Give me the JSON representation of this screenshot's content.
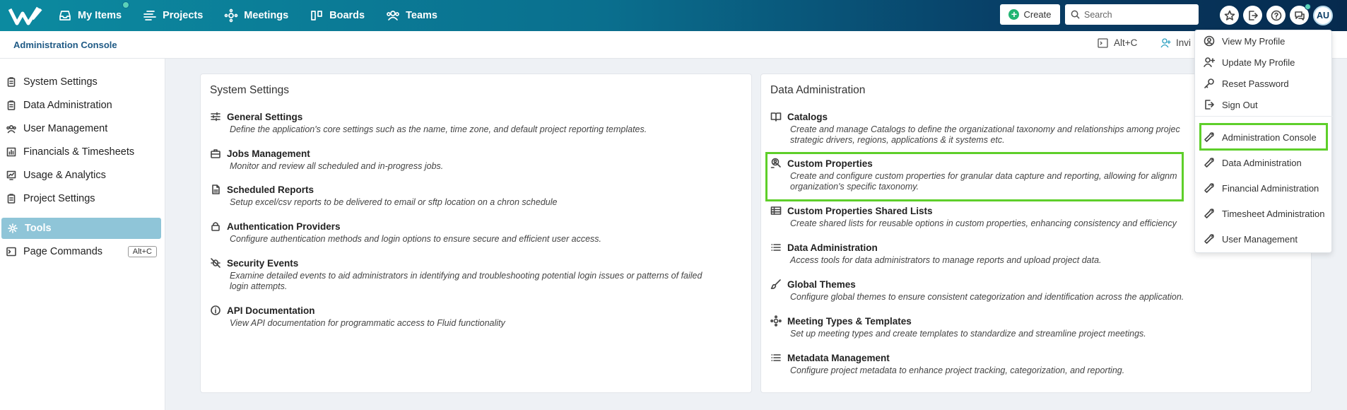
{
  "topnav": {
    "items": [
      {
        "label": "My Items",
        "icon": "inbox-icon"
      },
      {
        "label": "Projects",
        "icon": "projects-icon"
      },
      {
        "label": "Meetings",
        "icon": "meetings-icon"
      },
      {
        "label": "Boards",
        "icon": "boards-icon"
      },
      {
        "label": "Teams",
        "icon": "teams-icon"
      }
    ],
    "create_label": "Create",
    "search_placeholder": "Search",
    "avatar_initials": "AU"
  },
  "subheader": {
    "title": "Administration Console",
    "shortcut_label": "Alt+C",
    "invite_label": "Invi"
  },
  "sidebar": {
    "items": [
      {
        "label": "System Settings"
      },
      {
        "label": "Data Administration"
      },
      {
        "label": "User Management"
      },
      {
        "label": "Financials & Timesheets"
      },
      {
        "label": "Usage & Analytics"
      },
      {
        "label": "Project Settings"
      },
      {
        "label": "Tools",
        "active": true
      },
      {
        "label": "Page Commands",
        "shortcut": "Alt+C"
      }
    ]
  },
  "system_settings": {
    "title": "System Settings",
    "entries": [
      {
        "title": "General Settings",
        "desc": "Define the application's core settings such as the name, time zone, and default project reporting templates."
      },
      {
        "title": "Jobs Management",
        "desc": "Monitor and review all scheduled and in-progress jobs."
      },
      {
        "title": "Scheduled Reports",
        "desc": "Setup excel/csv reports to be delivered to email or sftp location on a chron schedule"
      },
      {
        "title": "Authentication Providers",
        "desc": "Configure authentication methods and login options to ensure secure and efficient user access."
      },
      {
        "title": "Security Events",
        "desc": "Examine detailed events to aid administrators in identifying and troubleshooting potential login issues or patterns of failed",
        "desc2": "login attempts."
      },
      {
        "title": "API Documentation",
        "desc": "View API documentation for programmatic access to Fluid functionality"
      }
    ]
  },
  "data_administration": {
    "title": "Data Administration",
    "entries": [
      {
        "title": "Catalogs",
        "desc": "Create and manage Catalogs to define the organizational taxonomy and relationships among projec",
        "desc2": "strategic drivers, regions, applications & it systems etc."
      },
      {
        "title": "Custom Properties",
        "desc": "Create and configure custom properties for granular data capture and reporting, allowing for alignm",
        "desc2": "organization's specific taxonomy."
      },
      {
        "title": "Custom Properties Shared Lists",
        "desc": "Create shared lists for reusable options in custom properties, enhancing consistency and efficiency"
      },
      {
        "title": "Data Administration",
        "desc": "Access tools for data administrators to manage reports and upload project data."
      },
      {
        "title": "Global Themes",
        "desc": "Configure global themes to ensure consistent categorization and identification across the application."
      },
      {
        "title": "Meeting Types & Templates",
        "desc": "Set up meeting types and create templates to standardize and streamline project meetings."
      },
      {
        "title": "Metadata Management",
        "desc": "Configure project metadata to enhance project tracking, categorization, and reporting."
      }
    ]
  },
  "profile_menu": {
    "items": [
      {
        "label": "View My Profile"
      },
      {
        "label": "Update My Profile"
      },
      {
        "label": "Reset Password"
      },
      {
        "label": "Sign Out"
      },
      {
        "label": "Administration Console"
      },
      {
        "label": "Data Administration"
      },
      {
        "label": "Financial Administration"
      },
      {
        "label": "Timesheet Administration"
      },
      {
        "label": "User Management"
      }
    ]
  },
  "colors": {
    "accent": "#0a6f8e",
    "active_sidebar": "#8fc5d8",
    "highlight": "#5ecf2a"
  }
}
